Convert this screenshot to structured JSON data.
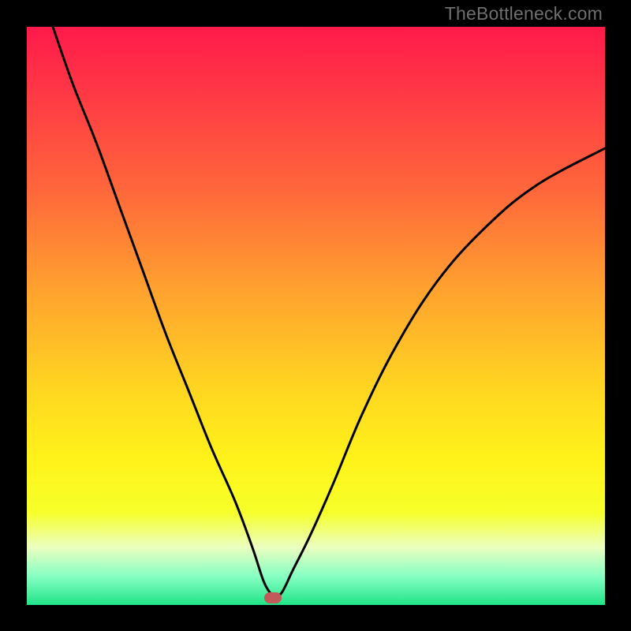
{
  "watermark": "TheBottleneck.com",
  "colors": {
    "frame": "#000000",
    "marker": "#c15a58",
    "gradient_stops": [
      {
        "offset": 0.0,
        "color": "#ff1a4a"
      },
      {
        "offset": 0.12,
        "color": "#ff3a45"
      },
      {
        "offset": 0.28,
        "color": "#ff663b"
      },
      {
        "offset": 0.45,
        "color": "#ffa02f"
      },
      {
        "offset": 0.62,
        "color": "#ffd421"
      },
      {
        "offset": 0.75,
        "color": "#fff31a"
      },
      {
        "offset": 0.84,
        "color": "#f6ff2a"
      },
      {
        "offset": 0.9,
        "color": "#ecffc0"
      },
      {
        "offset": 0.95,
        "color": "#87ffc3"
      },
      {
        "offset": 1.0,
        "color": "#20e487"
      }
    ]
  },
  "chart_data": {
    "type": "line",
    "title": "",
    "xlabel": "",
    "ylabel": "",
    "xlim": [
      0,
      100
    ],
    "ylim": [
      0,
      100
    ],
    "marker": {
      "x": 42.5,
      "y": 1.2
    },
    "series": [
      {
        "name": "left",
        "x": [
          4.5,
          8,
          12,
          16,
          20,
          24,
          28,
          32,
          36,
          39,
          41,
          42.5
        ],
        "y": [
          100,
          90,
          80,
          69,
          58,
          47,
          37,
          27,
          18,
          10,
          4,
          1.5
        ]
      },
      {
        "name": "right",
        "x": [
          42.5,
          44,
          46,
          49,
          53,
          58,
          64,
          71,
          79,
          88,
          100
        ],
        "y": [
          1.5,
          2,
          6,
          12,
          21,
          33,
          45,
          56,
          65,
          72.5,
          79
        ]
      }
    ]
  }
}
